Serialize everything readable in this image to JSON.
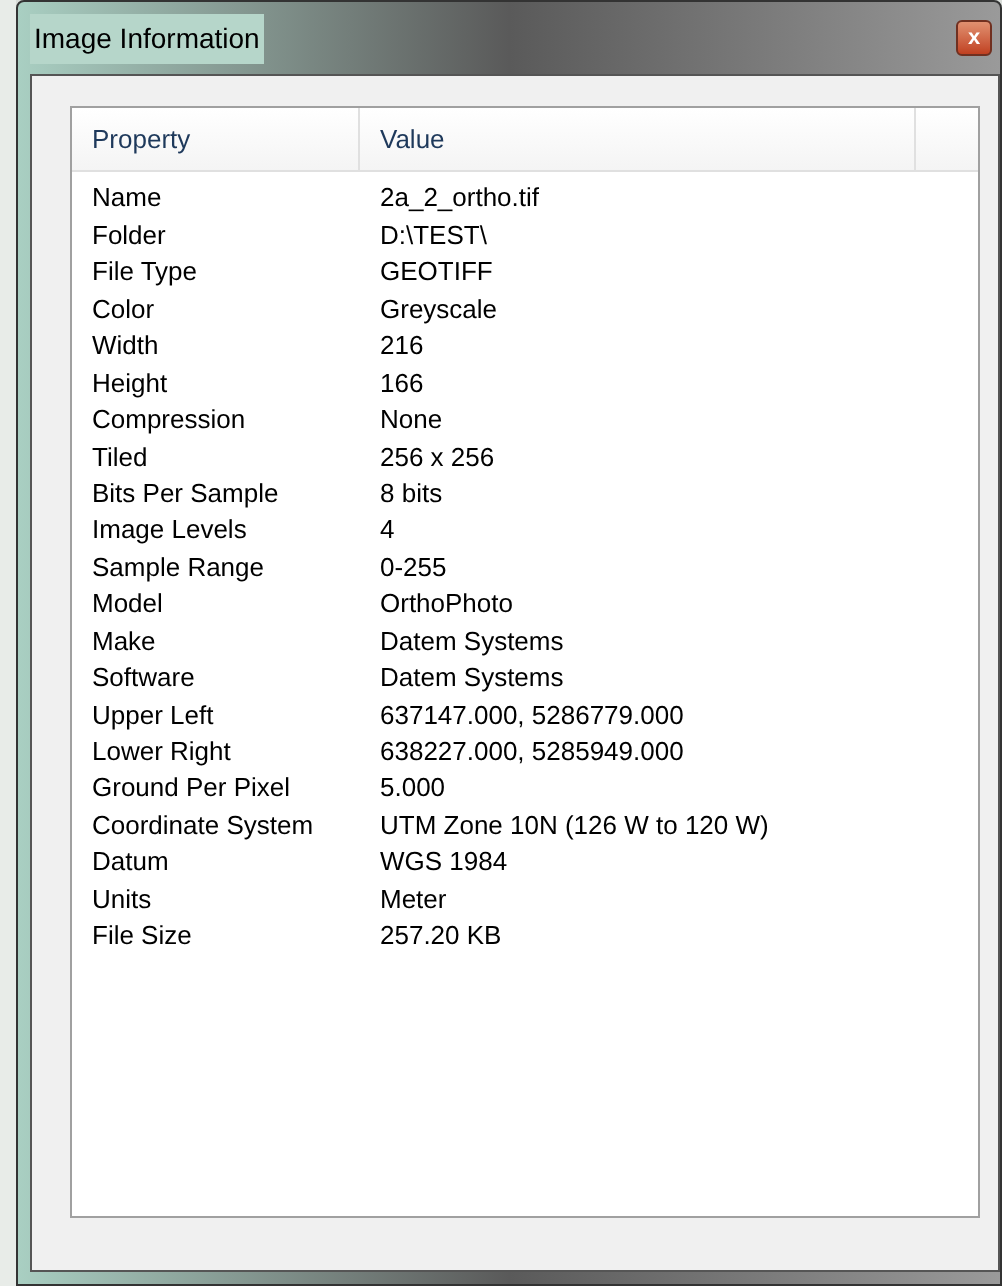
{
  "window": {
    "title": "Image Information",
    "close": "x"
  },
  "table": {
    "columns": [
      "Property",
      "Value"
    ],
    "rows": [
      {
        "property": "Name",
        "value": "2a_2_ortho.tif"
      },
      {
        "property": "Folder",
        "value": "D:\\TEST\\"
      },
      {
        "property": "File Type",
        "value": "GEOTIFF"
      },
      {
        "property": "Color",
        "value": "Greyscale"
      },
      {
        "property": "Width",
        "value": "216"
      },
      {
        "property": "Height",
        "value": "166"
      },
      {
        "property": "Compression",
        "value": "None"
      },
      {
        "property": "Tiled",
        "value": "256 x 256"
      },
      {
        "property": "Bits Per Sample",
        "value": "8 bits"
      },
      {
        "property": "Image Levels",
        "value": "4"
      },
      {
        "property": "Sample Range",
        "value": "0-255"
      },
      {
        "property": "Model",
        "value": "OrthoPhoto"
      },
      {
        "property": "Make",
        "value": "Datem Systems"
      },
      {
        "property": "Software",
        "value": "Datem Systems"
      },
      {
        "property": "Upper Left",
        "value": "637147.000, 5286779.000"
      },
      {
        "property": "Lower Right",
        "value": "638227.000, 5285949.000"
      },
      {
        "property": "Ground Per Pixel",
        "value": "5.000"
      },
      {
        "property": "Coordinate System",
        "value": "UTM Zone 10N (126 W to 120 W)"
      },
      {
        "property": "Datum",
        "value": "WGS 1984"
      },
      {
        "property": "Units",
        "value": "Meter"
      },
      {
        "property": "File Size",
        "value": "257.20 KB"
      }
    ]
  }
}
